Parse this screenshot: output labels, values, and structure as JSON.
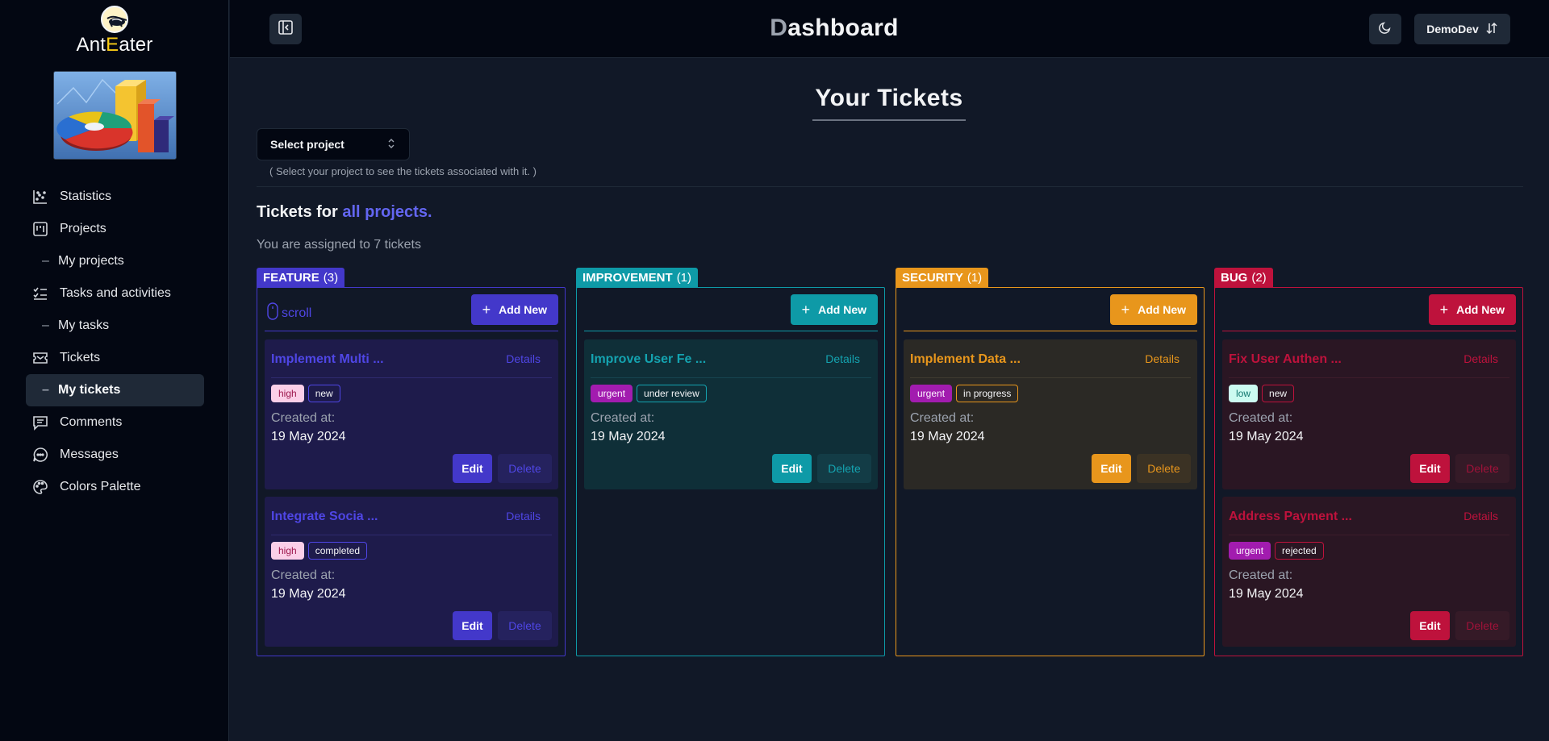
{
  "brand": {
    "name_start": "Ant",
    "name_mid": "E",
    "name_end": "ater"
  },
  "sidebar": {
    "items": [
      {
        "label": "Statistics",
        "icon": "chart-scatter-icon"
      },
      {
        "label": "Projects",
        "icon": "kanban-icon"
      },
      {
        "label": "My projects",
        "sub": true
      },
      {
        "label": "Tasks and activities",
        "icon": "list-checks-icon"
      },
      {
        "label": "My tasks",
        "sub": true
      },
      {
        "label": "Tickets",
        "icon": "ticket-icon"
      },
      {
        "label": "My tickets",
        "sub": true,
        "active": true
      },
      {
        "label": "Comments",
        "icon": "comment-icon"
      },
      {
        "label": "Messages",
        "icon": "message-circle-icon"
      },
      {
        "label": "Colors Palette",
        "icon": "palette-icon"
      }
    ]
  },
  "header": {
    "title_first": "D",
    "title_rest": "ashboard",
    "user": "DemoDev"
  },
  "main": {
    "title": "Your Tickets",
    "select_label": "Select project",
    "select_hint": "( Select your project to see the tickets associated with it. )",
    "tickets_for_prefix": "Tickets for ",
    "tickets_for_hl": "all projects.",
    "assigned": "You are assigned to 7 tickets"
  },
  "columns": [
    {
      "name": "FEATURE",
      "count": "(3)",
      "add_label": "Add New",
      "scroll_label": "scroll",
      "cards": [
        {
          "title": "Implement Multi ...",
          "details": "Details",
          "priority": "high",
          "status": "new",
          "created_label": "Created at:",
          "date": "19 May 2024",
          "edit": "Edit",
          "delete": "Delete"
        },
        {
          "title": "Integrate Socia ...",
          "details": "Details",
          "priority": "high",
          "status": "completed",
          "created_label": "Created at:",
          "date": "19 May 2024",
          "edit": "Edit",
          "delete": "Delete"
        }
      ]
    },
    {
      "name": "IMPROVEMENT",
      "count": "(1)",
      "add_label": "Add New",
      "cards": [
        {
          "title": "Improve User Fe ...",
          "details": "Details",
          "priority": "urgent",
          "status": "under review",
          "created_label": "Created at:",
          "date": "19 May 2024",
          "edit": "Edit",
          "delete": "Delete"
        }
      ]
    },
    {
      "name": "SECURITY",
      "count": "(1)",
      "add_label": "Add New",
      "cards": [
        {
          "title": "Implement Data ...",
          "details": "Details",
          "priority": "urgent",
          "status": "in progress",
          "created_label": "Created at:",
          "date": "19 May 2024",
          "edit": "Edit",
          "delete": "Delete"
        }
      ]
    },
    {
      "name": "BUG",
      "count": "(2)",
      "add_label": "Add New",
      "cards": [
        {
          "title": "Fix User Authen ...",
          "details": "Details",
          "priority": "low",
          "status": "new",
          "created_label": "Created at:",
          "date": "19 May 2024",
          "edit": "Edit",
          "delete": "Delete"
        },
        {
          "title": "Address Payment ...",
          "details": "Details",
          "priority": "urgent",
          "status": "rejected",
          "created_label": "Created at:",
          "date": "19 May 2024",
          "edit": "Edit",
          "delete": "Delete"
        }
      ]
    }
  ],
  "colors": {
    "feature": "#4338ca",
    "improvement": "#0e9aa7",
    "security": "#e8961c",
    "bug": "#be123c",
    "tag_high": "#fbcfe8",
    "tag_urgent": "#a21caf",
    "tag_low": "#ccfbf1"
  }
}
